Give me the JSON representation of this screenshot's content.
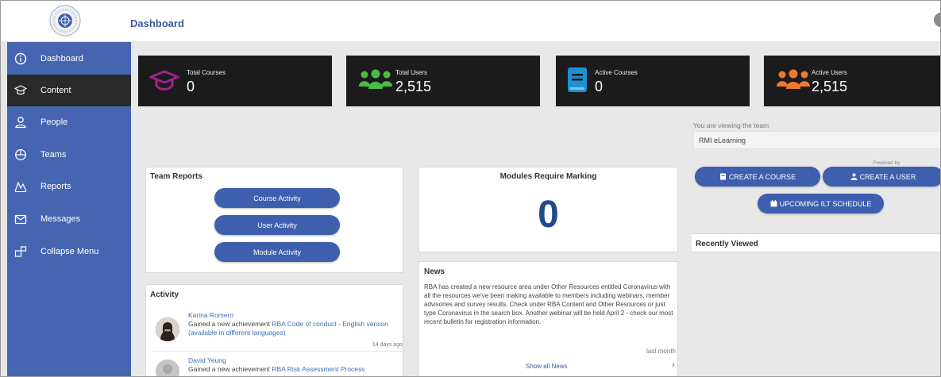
{
  "header": {
    "title": "Dashboard",
    "logo_icon": "responsible-initiative-seal"
  },
  "sidebar": {
    "items": [
      {
        "label": "Dashboard",
        "icon": "info-circle-icon",
        "active": false
      },
      {
        "label": "Content",
        "icon": "graduation-cap-icon",
        "active": true
      },
      {
        "label": "People",
        "icon": "person-icon",
        "active": false
      },
      {
        "label": "Teams",
        "icon": "teams-icon",
        "active": false
      },
      {
        "label": "Reports",
        "icon": "chart-icon",
        "active": false
      },
      {
        "label": "Messages",
        "icon": "envelope-icon",
        "active": false
      },
      {
        "label": "Collapse Menu",
        "icon": "collapse-icon",
        "active": false
      }
    ]
  },
  "stats": [
    {
      "label": "Total Courses",
      "value": "0",
      "icon": "graduation-cap-icon",
      "color": "#9c1f8a"
    },
    {
      "label": "Total Users",
      "value": "2,515",
      "icon": "users-icon",
      "color": "#4cbb4a"
    },
    {
      "label": "Active Courses",
      "value": "0",
      "icon": "book-icon",
      "color": "#1f8fd6"
    },
    {
      "label": "Active Users",
      "value": "2,515",
      "icon": "users-icon",
      "color": "#f07a2a"
    }
  ],
  "team": {
    "label": "You are viewing the team",
    "value": "RMI eLearning",
    "powered_by": "Powered by"
  },
  "actions": {
    "create_course": "CREATE A COURSE",
    "create_user": "CREATE A USER",
    "upcoming_ilt": "UPCOMING ILT SCHEDULE"
  },
  "recently_viewed": {
    "title": "Recently Viewed"
  },
  "team_reports": {
    "title": "Team Reports",
    "buttons": [
      "Course Activity",
      "User Activity",
      "Module Activity"
    ]
  },
  "modules_marking": {
    "title": "Modules Require Marking",
    "value": "0"
  },
  "news": {
    "title": "News",
    "body": "RBA has created a new resource area under Other Resources entitled Coronavirus with all the resources we've been making available to members including webinars, member advisories and survey results. Check under RBA Content and Other Resources or just type Coronavirus in the search box. Another webinar will be held April 2 - check our most recent bulletin for registration information.",
    "date": "last month",
    "show_all": "Show all News"
  },
  "activity": {
    "title": "Activity",
    "items": [
      {
        "name": "Karina Romero",
        "prefix": "Gained a new achievement",
        "link": "RBA Code of conduct - English version (available in different languages)",
        "time": "14 days ago"
      },
      {
        "name": "David Yeung",
        "prefix": "Gained a new achievement",
        "link": "RBA Risk Assessment Process",
        "time": ""
      }
    ]
  },
  "colors": {
    "sidebar": "#4665b0",
    "sidebar_active": "#2a2a2a",
    "accent": "#3d5fae",
    "stat_bg": "#1b1b1b"
  }
}
